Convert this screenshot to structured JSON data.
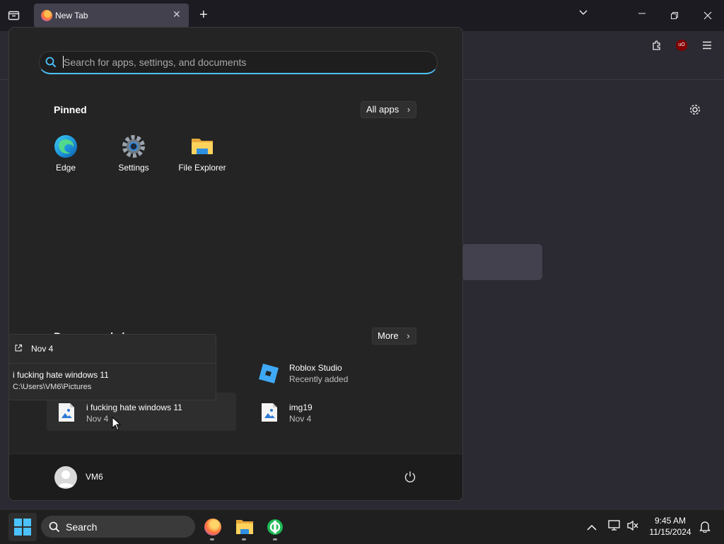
{
  "browser": {
    "tab_title": "New Tab",
    "tab_close": "✕",
    "new_tab": "+",
    "list_all_tabs": "⌄",
    "window_controls": {
      "minimize": "—",
      "restore": "❐",
      "close": "✕"
    },
    "addon_badge": "uO"
  },
  "start_menu": {
    "search_placeholder": "Search for apps, settings, and documents",
    "pinned": {
      "title": "Pinned",
      "all_apps_label": "All apps",
      "items": [
        {
          "label": "Edge",
          "icon": "edge-icon"
        },
        {
          "label": "Settings",
          "icon": "settings-gear-icon"
        },
        {
          "label": "File Explorer",
          "icon": "folder-icon"
        }
      ]
    },
    "recommended": {
      "title": "Recommended",
      "more_label": "More",
      "items": [
        {
          "name": "Roblox Studio",
          "sub": "Recently added",
          "icon": "roblox-studio-icon"
        },
        {
          "name": "i fucking hate windows 11",
          "sub": "Nov 4",
          "icon": "image-file-icon"
        },
        {
          "name": "img19",
          "sub": "Nov 4",
          "icon": "image-file-icon"
        }
      ]
    },
    "tooltip": {
      "date": "Nov 4",
      "name": "i fucking hate windows 11",
      "path": "C:\\Users\\VM6\\Pictures"
    },
    "user": {
      "name": "VM6"
    }
  },
  "taskbar": {
    "search_label": "Search",
    "clock": {
      "time": "9:45 AM",
      "date": "11/15/2024"
    }
  },
  "colors": {
    "accent": "#4cc2ff",
    "start_bg": "#242424",
    "taskbar_bg": "#1f1f1f"
  }
}
